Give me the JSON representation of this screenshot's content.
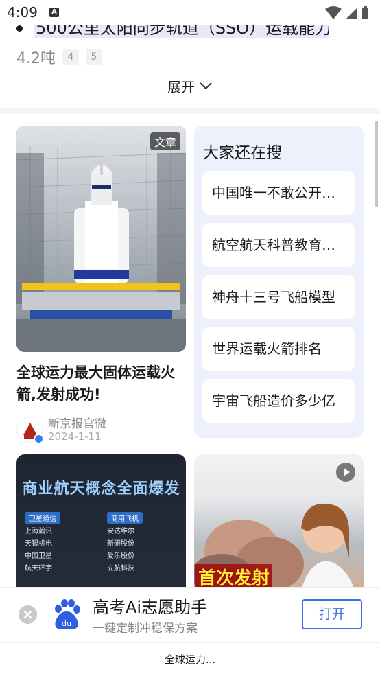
{
  "status_bar": {
    "time": "4:09",
    "notif_icon_letter": "A"
  },
  "article_snippet": {
    "highlighted_line": "500公里太阳同步轨道（SSO）运载能力：",
    "weight_value": "4.2吨",
    "references": [
      "4",
      "5"
    ],
    "expand_label": "展开"
  },
  "feed": {
    "article_card": {
      "tag": "文章",
      "title": "全球运力最大固体运载火箭,发射成功!",
      "author": "新京报官微",
      "date": "2024-1-11"
    },
    "people_also_search": {
      "title": "大家还在搜",
      "items": [
        "中国唯一不敢公开的太空技术",
        "航空航天科普教育基地",
        "神舟十三号飞船模型",
        "世界运载火箭排名",
        "宇宙飞船造价多少亿"
      ]
    },
    "poster_card": {
      "title": "商业航天概念全面爆发",
      "left_header": "卫星通信",
      "right_header": "商用飞机",
      "left_items": [
        "上海瀚讯",
        "天银机电",
        "中国卫星",
        "航天环宇"
      ],
      "right_items": [
        "安达维尔",
        "新研股份",
        "爱乐股份",
        "立航科技"
      ]
    },
    "video_card": {
      "caption": "首次发射"
    }
  },
  "promo_banner": {
    "title": "高考Ai志愿助手",
    "subtitle": "一键定制冲稳保方案",
    "open_label": "打开",
    "colors": {
      "accent": "#3b6ee6"
    }
  },
  "bottom_caption": "全球运力..."
}
